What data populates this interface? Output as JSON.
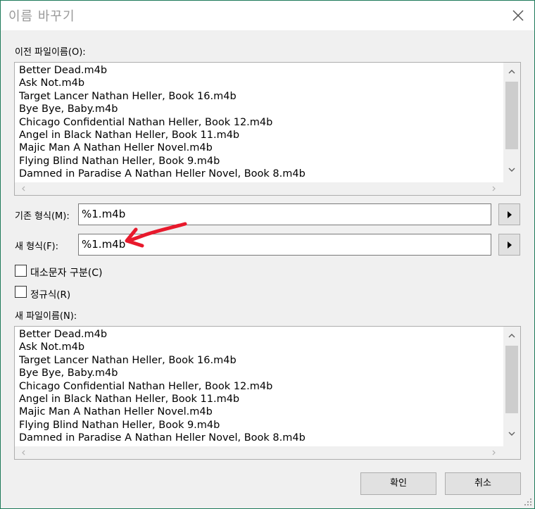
{
  "window": {
    "title": "이름 바꾸기"
  },
  "old_names": {
    "label": "이전 파일이름(O):",
    "items": [
      "Better Dead.m4b",
      "Ask Not.m4b",
      "Target Lancer Nathan Heller, Book 16.m4b",
      "Bye Bye, Baby.m4b",
      "Chicago Confidential Nathan Heller, Book 12.m4b",
      "Angel in Black Nathan Heller, Book 11.m4b",
      "Majic Man A Nathan Heller Novel.m4b",
      "Flying Blind Nathan Heller, Book 9.m4b",
      "Damned in Paradise A Nathan Heller Novel, Book 8.m4b"
    ]
  },
  "base_format": {
    "label": "기존 형식(M):",
    "value": "%1.m4b"
  },
  "new_format": {
    "label": "새 형식(F):",
    "value": "%1.m4b"
  },
  "options": {
    "case_sensitive": {
      "label": "대소문자 구분(C)",
      "checked": false
    },
    "regex": {
      "label": "정규식(R)",
      "checked": false
    }
  },
  "new_names": {
    "label": "새 파일이름(N):",
    "items": [
      "Better Dead.m4b",
      "Ask Not.m4b",
      "Target Lancer Nathan Heller, Book 16.m4b",
      "Bye Bye, Baby.m4b",
      "Chicago Confidential Nathan Heller, Book 12.m4b",
      "Angel in Black Nathan Heller, Book 11.m4b",
      "Majic Man A Nathan Heller Novel.m4b",
      "Flying Blind Nathan Heller, Book 9.m4b",
      "Damned in Paradise A Nathan Heller Novel, Book 8.m4b"
    ]
  },
  "buttons": {
    "ok": "확인",
    "cancel": "취소"
  },
  "colors": {
    "annotation_arrow": "#e8192c",
    "window_border": "#1e7a5a"
  },
  "icons": [
    "close-icon",
    "scroll-up-icon",
    "scroll-down-icon",
    "scroll-left-icon",
    "scroll-right-icon",
    "play-arrow-icon",
    "resize-grip-icon",
    "red-annotation-arrow"
  ]
}
